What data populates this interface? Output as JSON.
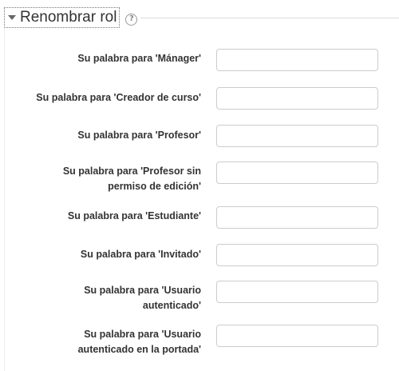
{
  "section": {
    "title": "Renombrar rol",
    "collapse_icon": "caret-down-icon",
    "help_icon": "question-circle-icon",
    "help_glyph": "?"
  },
  "fields": [
    {
      "label_line1": "Su palabra para 'Mánager'",
      "label_line2": "",
      "value": ""
    },
    {
      "label_line1": "Su palabra para 'Creador de curso'",
      "label_line2": "",
      "value": ""
    },
    {
      "label_line1": "Su palabra para 'Profesor'",
      "label_line2": "",
      "value": ""
    },
    {
      "label_line1": "Su palabra para 'Profesor sin",
      "label_line2": "permiso de edición'",
      "value": ""
    },
    {
      "label_line1": "Su palabra para 'Estudiante'",
      "label_line2": "",
      "value": ""
    },
    {
      "label_line1": "Su palabra para 'Invitado'",
      "label_line2": "",
      "value": ""
    },
    {
      "label_line1": "Su palabra para 'Usuario",
      "label_line2": "autenticado'",
      "value": ""
    },
    {
      "label_line1": "Su palabra para 'Usuario",
      "label_line2": "autenticado en la portada'",
      "value": ""
    }
  ]
}
